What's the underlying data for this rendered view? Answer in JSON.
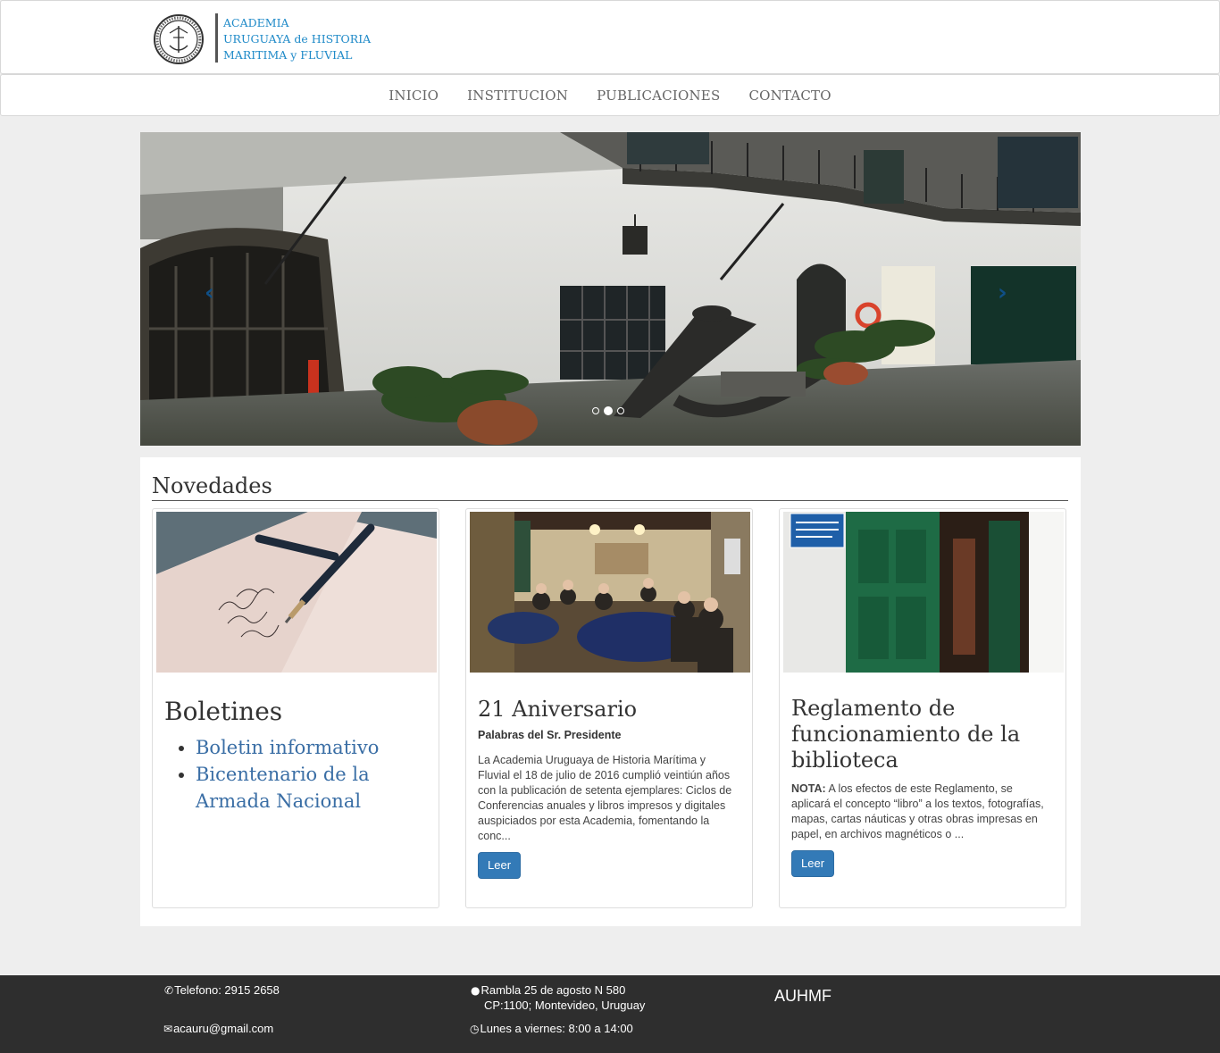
{
  "header": {
    "logo_lines": [
      "ACADEMIA",
      "URUGUAYA de HISTORIA",
      "MARITIMA y FLUVIAL"
    ]
  },
  "nav": {
    "items": [
      "INICIO",
      "INSTITUCION",
      "PUBLICACIONES",
      "CONTACTO"
    ]
  },
  "carousel": {
    "prev_label": "‹",
    "next_label": "›",
    "slide_count": 3,
    "active_slide": 2
  },
  "news": {
    "title": "Novedades",
    "cards": [
      {
        "title": "Boletines",
        "links": [
          "Boletin informativo",
          "Bicentenario de la Armada Nacional"
        ]
      },
      {
        "title": "21 Aniversario",
        "subtitle": "Palabras del Sr. Presidente",
        "body": "La Academia Uruguaya de Historia Marítima y Fluvial el 18 de julio de 2016 cumplió veintiún años con la publicación de setenta ejemplares: Ciclos de Conferencias anuales y libros impresos y digitales auspiciados por esta Academia, fomentando la conc...",
        "button": "Leer"
      },
      {
        "title": "Reglamento de funcionamiento de la biblioteca",
        "note_label": "NOTA:",
        "body": " A los efectos de este Reglamento, se aplicará el concepto “libro” a los textos, fotografías, mapas, cartas náuticas y otras obras impresas en papel, en archivos magnéticos o ...",
        "button": "Leer"
      }
    ]
  },
  "footer": {
    "phone": "Telefono: 2915 2658",
    "email": "acauru@gmail.com",
    "address_line1": "Rambla 25 de agosto N 580",
    "address_line2": "CP:1100; Montevideo, Uruguay",
    "hours": "Lunes a viernes: 8:00 a 14:00",
    "brand": "AUHMF"
  }
}
